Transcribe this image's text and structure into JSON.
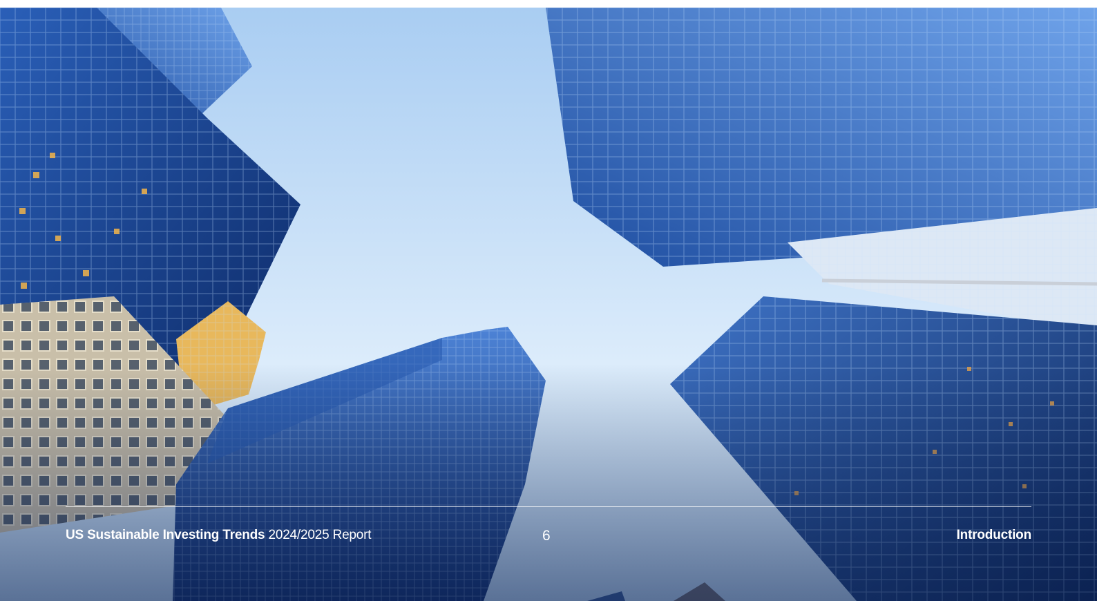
{
  "photo": {
    "subject": "upward-view-glass-skyscrapers",
    "colors": {
      "sky_top": "#a9cdf2",
      "sky_bottom": "#e6f2fc",
      "glass_dark": "#0f2f6e",
      "glass_mid": "#2f66c3",
      "glass_light": "#8ab7ef",
      "stone": "#c9bfa9",
      "gold": "#e8b85c"
    }
  },
  "footer": {
    "report_title_bold": "US Sustainable Investing Trends",
    "report_title_rest": " 2024/2025 Report",
    "page_number": "6",
    "section": "Introduction",
    "text_color": "#ffffff"
  }
}
